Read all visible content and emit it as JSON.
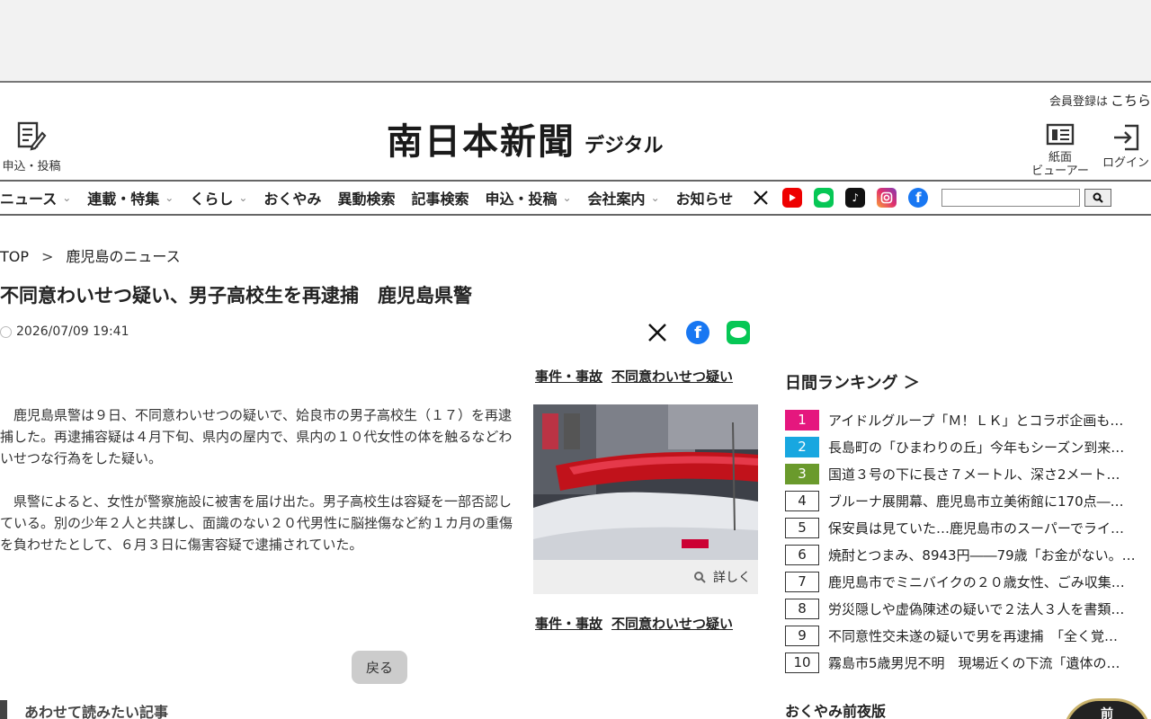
{
  "header": {
    "member_text": "会員登録は",
    "member_link": "こちら",
    "apply_label": "申込・投稿",
    "logo_main": "南日本新聞",
    "logo_sub": "デジタル",
    "viewer_label_1": "紙面",
    "viewer_label_2": "ビューアー",
    "login_label": "ログイン"
  },
  "nav": {
    "items": [
      {
        "label": "ニュース",
        "has_menu": true
      },
      {
        "label": "連載・特集",
        "has_menu": true
      },
      {
        "label": "くらし",
        "has_menu": true
      },
      {
        "label": "おくやみ",
        "has_menu": false
      },
      {
        "label": "異動検索",
        "has_menu": false
      },
      {
        "label": "記事検索",
        "has_menu": false
      },
      {
        "label": "申込・投稿",
        "has_menu": true
      },
      {
        "label": "会社案内",
        "has_menu": true
      },
      {
        "label": "お知らせ",
        "has_menu": false
      }
    ],
    "sns_icons": [
      "x-icon",
      "youtube-icon",
      "line-icon",
      "tiktok-icon",
      "instagram-icon",
      "facebook-icon"
    ],
    "search_placeholder": ""
  },
  "breadcrumb": {
    "top": "TOP",
    "separator": ">",
    "current": "鹿児島のニュース"
  },
  "article": {
    "title": "不同意わいせつ疑い、男子高校生を再逮捕　鹿児島県警",
    "date": "2026/07/09 19:41",
    "paragraphs": [
      "鹿児島県警は９日、不同意わいせつの疑いで、姶良市の男子高校生（１７）を再逮捕した。再逮捕容疑は４月下旬、県内の屋内で、県内の１０代女性の体を触るなどわいせつな行為をした疑い。",
      "県警によると、女性が警察施設に被害を届け出た。男子高校生は容疑を一部否認している。別の少年２人と共謀し、面識のない２０代男性に脳挫傷など約１カ月の重傷を負わせたとして、６月３日に傷害容疑で逮捕されていた。"
    ],
    "tags": [
      "事件・事故",
      "不同意わいせつ疑い"
    ],
    "photo_caption": "詳しく",
    "back_label": "戻る",
    "related_heading": "あわせて読みたい記事"
  },
  "ranking": {
    "heading": "日間ランキング ＞",
    "items": [
      {
        "num": "1",
        "text": "アイドルグループ「Ｍ！ＬＫ」とコラボ企画も…",
        "color": "#e5177e"
      },
      {
        "num": "2",
        "text": "長島町の「ひまわりの丘」今年もシーズン到来…",
        "color": "#18a7e0"
      },
      {
        "num": "3",
        "text": "国道３号の下に長さ７メートル、深さ2メート…",
        "color": "#6a9a2c"
      },
      {
        "num": "4",
        "text": "ブルーナ展開幕、鹿児島市立美術館に170点―…",
        "color": ""
      },
      {
        "num": "5",
        "text": "保安員は見ていた…鹿児島市のスーパーでライ…",
        "color": ""
      },
      {
        "num": "6",
        "text": "焼酎とつまみ、8943円――79歳「お金がない。…",
        "color": ""
      },
      {
        "num": "7",
        "text": "鹿児島市でミニバイクの２０歳女性、ごみ収集…",
        "color": ""
      },
      {
        "num": "8",
        "text": "労災隠しや虚偽陳述の疑いで２法人３人を書類…",
        "color": ""
      },
      {
        "num": "9",
        "text": "不同意性交未遂の疑いで男を再逮捕　「全く覚…",
        "color": ""
      },
      {
        "num": "10",
        "text": "霧島市5歳男児不明　現場近くの下流「遺体の…",
        "color": ""
      }
    ]
  },
  "okuyami": {
    "heading": "おくやみ前夜版",
    "badge": "前"
  }
}
